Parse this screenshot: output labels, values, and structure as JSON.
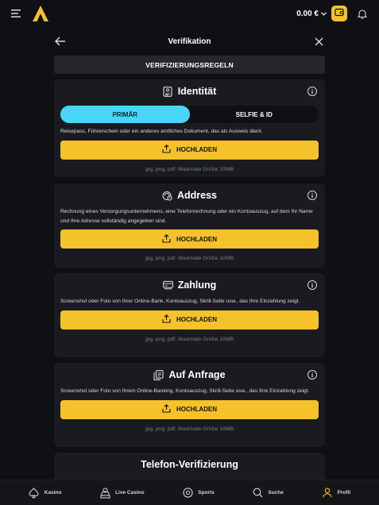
{
  "topbar": {
    "balance": "0.00 €",
    "balance_chevron": "chevron-down-icon",
    "icons": [
      "menu-icon",
      "logo",
      "wallet-icon",
      "bell-icon"
    ]
  },
  "header": {
    "title": "Verifikation",
    "back_icon": "arrow-left-icon",
    "close_icon": "close-icon"
  },
  "rules": {
    "label": "VERIFIZIERUNGSREGELN"
  },
  "cards": [
    {
      "title": "Identität",
      "icon": "id-document-icon",
      "tabs": [
        "PRIMÄR",
        "SELFIE & ID"
      ],
      "active_tab": "PRIMÄR",
      "description": "Reisepass, Führerschein oder ein anderes amtliches Dokument, das als Ausweis dient.",
      "upload_label": "HOCHLADEN",
      "formats": "jpg, png, pdf. Maximale Größe 10MB"
    },
    {
      "title": "Address",
      "icon": "address-icon",
      "description": "Rechnung eines Versorgungsunternehmens, eine Telefonrechnung oder ein Kontoauszug, auf dem Ihr Name und Ihre Adresse vollständig angegeben sind.",
      "upload_label": "HOCHLADEN",
      "formats": "jpg, png, pdf. Maximale Größe 10MB"
    },
    {
      "title": "Zahlung",
      "icon": "payment-icon",
      "description": "Screenshot oder Foto von Ihrer Online-Bank, Kontoauszug, Skrill-Seite usw., das Ihre Einzahlung zeigt.",
      "upload_label": "HOCHLADEN",
      "formats": "jpg, png, pdf. Maximale Größe 10MB"
    },
    {
      "title": "Auf Anfrage",
      "icon": "documents-icon",
      "description": "Screenshot oder Foto von Ihrem Online-Banking, Kontoauszug, Skrill-Seite usw., das Ihre Einzahlung zeigt.",
      "upload_label": "HOCHLADEN",
      "formats": "jpg, png, pdf. Maximale Größe 10MB"
    },
    {
      "title": "Telefon-Verifizierung"
    }
  ],
  "bottom_nav": [
    {
      "label": "Kasino",
      "icon": "spade-icon"
    },
    {
      "label": "Live Casino",
      "icon": "dealer-icon"
    },
    {
      "label": "Sports",
      "icon": "soccer-ball-icon"
    },
    {
      "label": "Suche",
      "icon": "search-icon"
    },
    {
      "label": "Profil",
      "icon": "user-icon"
    }
  ],
  "colors": {
    "accent": "#f5c22b",
    "tab_active": "#48d6f6",
    "profile_active": "#f5c22b"
  }
}
